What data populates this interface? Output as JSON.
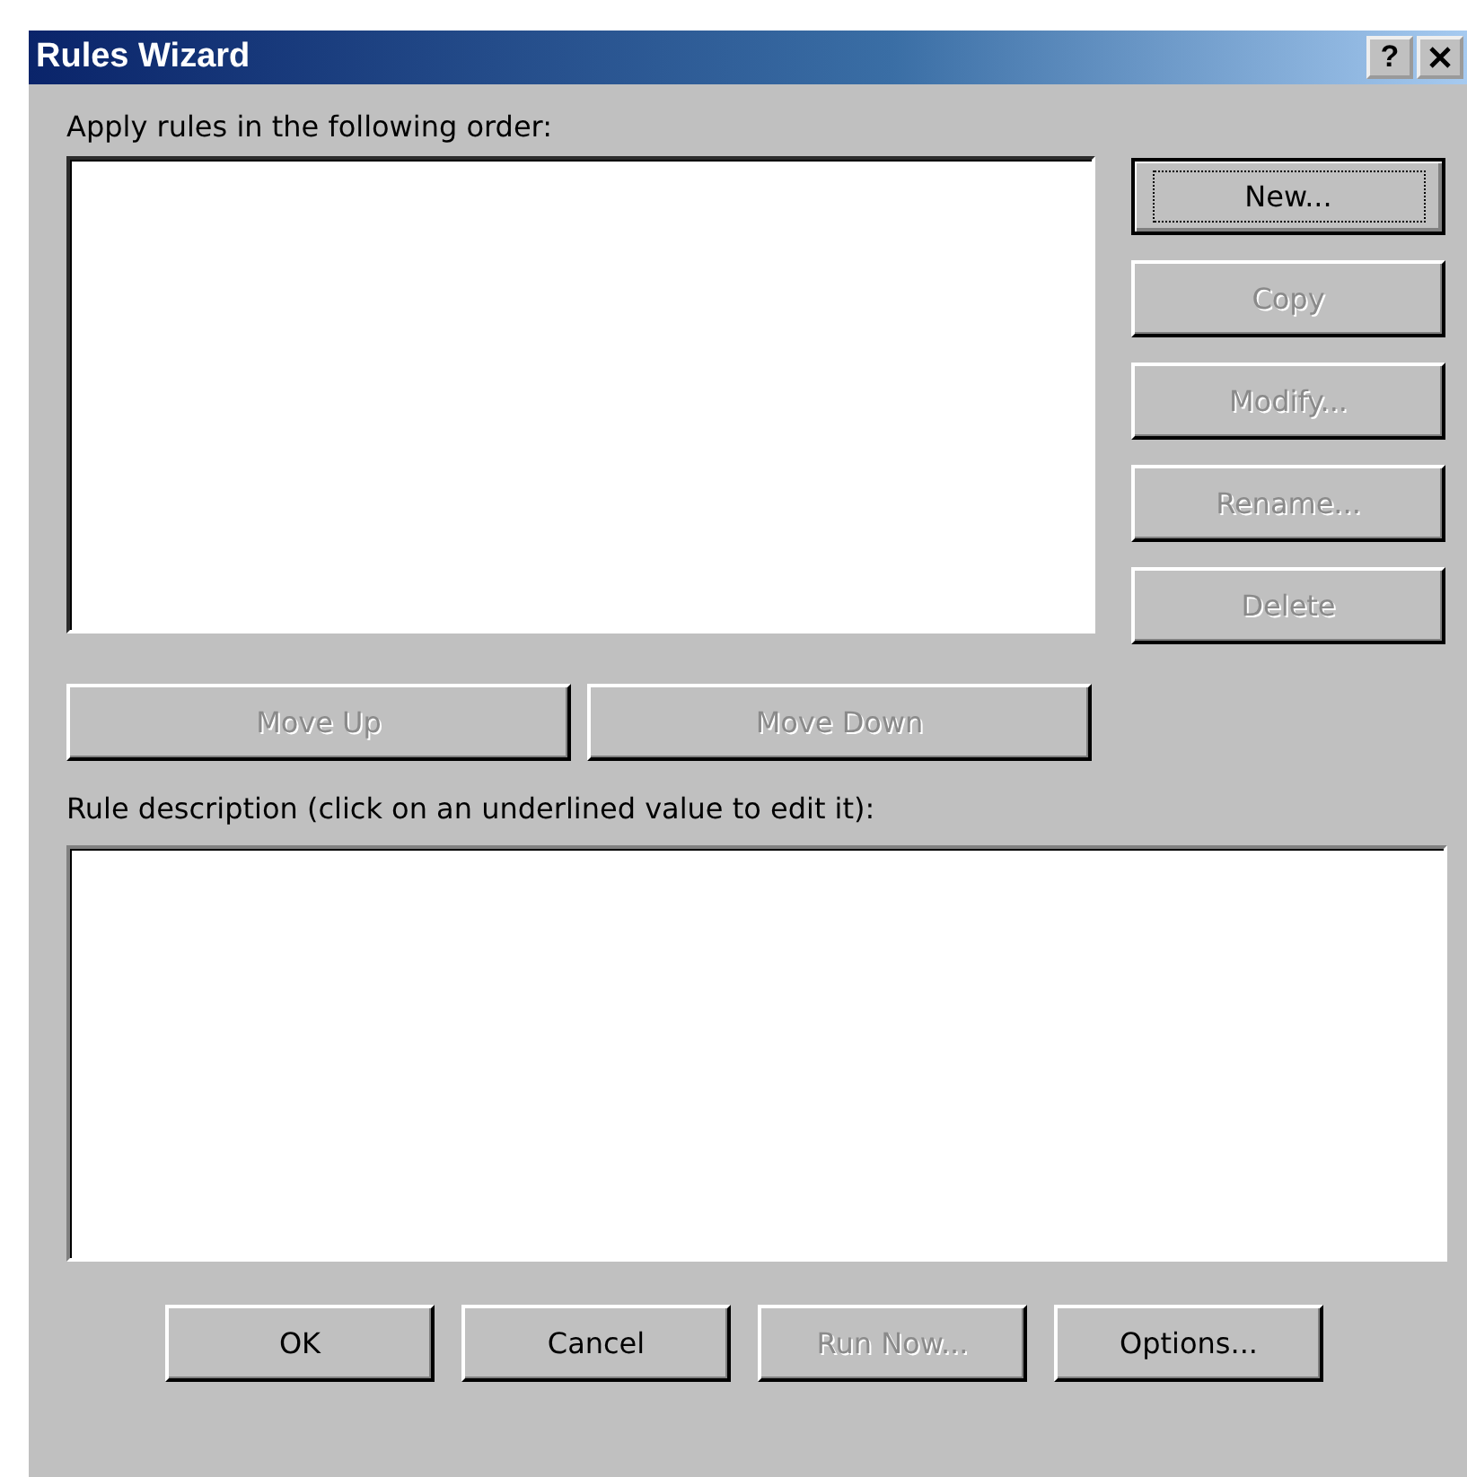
{
  "window": {
    "title": "Rules Wizard",
    "help_button": "?"
  },
  "rules_list": {
    "label": "Apply rules in the following order:"
  },
  "side_buttons": [
    {
      "label": "New...",
      "disabled": false,
      "focused": true
    },
    {
      "label": "Copy",
      "disabled": true,
      "focused": false
    },
    {
      "label": "Modify...",
      "disabled": true,
      "focused": false
    },
    {
      "label": "Rename...",
      "disabled": true,
      "focused": false
    },
    {
      "label": "Delete",
      "disabled": true,
      "focused": false
    }
  ],
  "move_buttons": [
    {
      "label": "Move Up",
      "disabled": true
    },
    {
      "label": "Move Down",
      "disabled": true
    }
  ],
  "description": {
    "label": "Rule description (click on an underlined value to edit it):"
  },
  "buttons": [
    {
      "label": "OK",
      "disabled": false
    },
    {
      "label": "Cancel",
      "disabled": false
    },
    {
      "label": "Run Now...",
      "disabled": true
    },
    {
      "label": "Options...",
      "disabled": false
    }
  ]
}
